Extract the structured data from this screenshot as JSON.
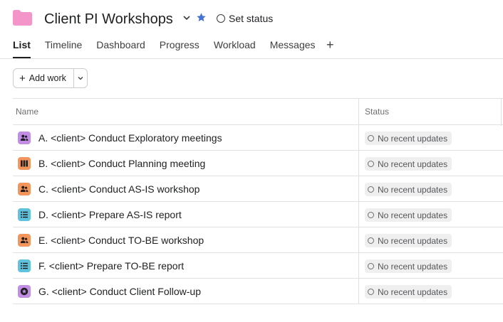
{
  "project": {
    "title": "Client PI Workshops",
    "folder_icon": "folder-icon",
    "folder_color": "#f395c9",
    "star_color": "#4573d2",
    "set_status_label": "Set status"
  },
  "tabs": [
    {
      "label": "List",
      "active": true
    },
    {
      "label": "Timeline",
      "active": false
    },
    {
      "label": "Dashboard",
      "active": false
    },
    {
      "label": "Progress",
      "active": false
    },
    {
      "label": "Workload",
      "active": false
    },
    {
      "label": "Messages",
      "active": false
    }
  ],
  "toolbar": {
    "add_work_label": "Add work"
  },
  "table": {
    "columns": {
      "name": "Name",
      "status": "Status"
    },
    "rows": [
      {
        "name": "A. <client> Conduct Exploratory meetings",
        "icon": "people-icon",
        "icon_color": "#c28de5",
        "status": "No recent updates"
      },
      {
        "name": "B. <client> Conduct Planning meeting",
        "icon": "board-icon",
        "icon_color": "#f4955b",
        "status": "No recent updates"
      },
      {
        "name": "C. <client> Conduct AS-IS workshop",
        "icon": "people-icon",
        "icon_color": "#f4955b",
        "status": "No recent updates"
      },
      {
        "name": "D. <client> Prepare AS-IS report",
        "icon": "list-icon",
        "icon_color": "#5fc3dd",
        "status": "No recent updates"
      },
      {
        "name": "E. <client> Conduct TO-BE workshop",
        "icon": "people-icon",
        "icon_color": "#f4955b",
        "status": "No recent updates"
      },
      {
        "name": "F. <client> Prepare TO-BE report",
        "icon": "list-icon",
        "icon_color": "#5fc3dd",
        "status": "No recent updates"
      },
      {
        "name": "G. <client> Conduct Client Follow-up",
        "icon": "star-badge-icon",
        "icon_color": "#c28de5",
        "status": "No recent updates"
      }
    ]
  }
}
